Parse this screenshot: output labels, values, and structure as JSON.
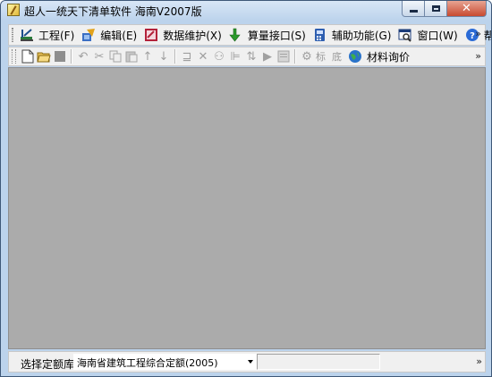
{
  "window": {
    "title": "超人一统天下清单软件 海南V2007版"
  },
  "menubar": {
    "items": [
      {
        "label": "工程(F)",
        "icon": "project-icon"
      },
      {
        "label": "编辑(E)",
        "icon": "edit-icon"
      },
      {
        "label": "数据维护(X)",
        "icon": "data-maintenance-icon"
      },
      {
        "label": "算量接口(S)",
        "icon": "quantity-interface-icon"
      },
      {
        "label": "辅助功能(G)",
        "icon": "auxiliary-icon"
      },
      {
        "label": "窗口(W)",
        "icon": "window-icon"
      },
      {
        "label": "帮助(H)",
        "icon": "help-icon"
      }
    ],
    "overflow": "»"
  },
  "toolbar": {
    "text_biao": "标",
    "text_di": "底",
    "material_price_label": "材料询价",
    "overflow": "»"
  },
  "statusbar": {
    "quota_label": "选择定额库",
    "quota_value": "海南省建筑工程综合定额(2005)",
    "overflow": "»"
  },
  "colors": {
    "workspace": "#ababab",
    "chrome": "#f0f0f0",
    "close_button": "#c74a30"
  }
}
